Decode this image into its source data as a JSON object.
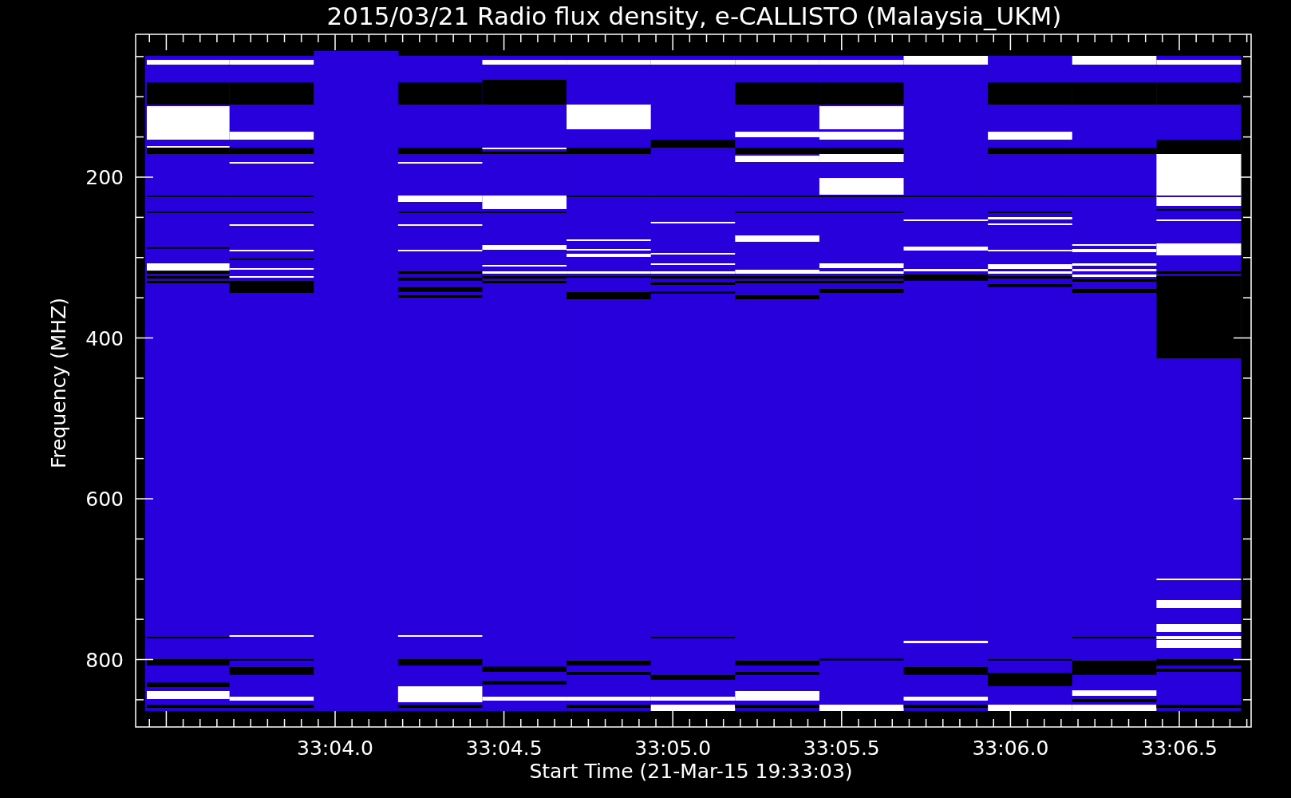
{
  "title": "2015/03/21  Radio flux density, e-CALLISTO (Malaysia_UKM)",
  "y_axis": {
    "label": "Frequency (MHZ)",
    "ticks": [
      "200",
      "400",
      "600",
      "800"
    ]
  },
  "x_axis": {
    "label": "Start Time (21-Mar-15 19:33:03)",
    "ticks": [
      "33:04.0",
      "33:04.5",
      "33:05.0",
      "33:05.5",
      "33:06.0",
      "33:06.5"
    ]
  }
}
